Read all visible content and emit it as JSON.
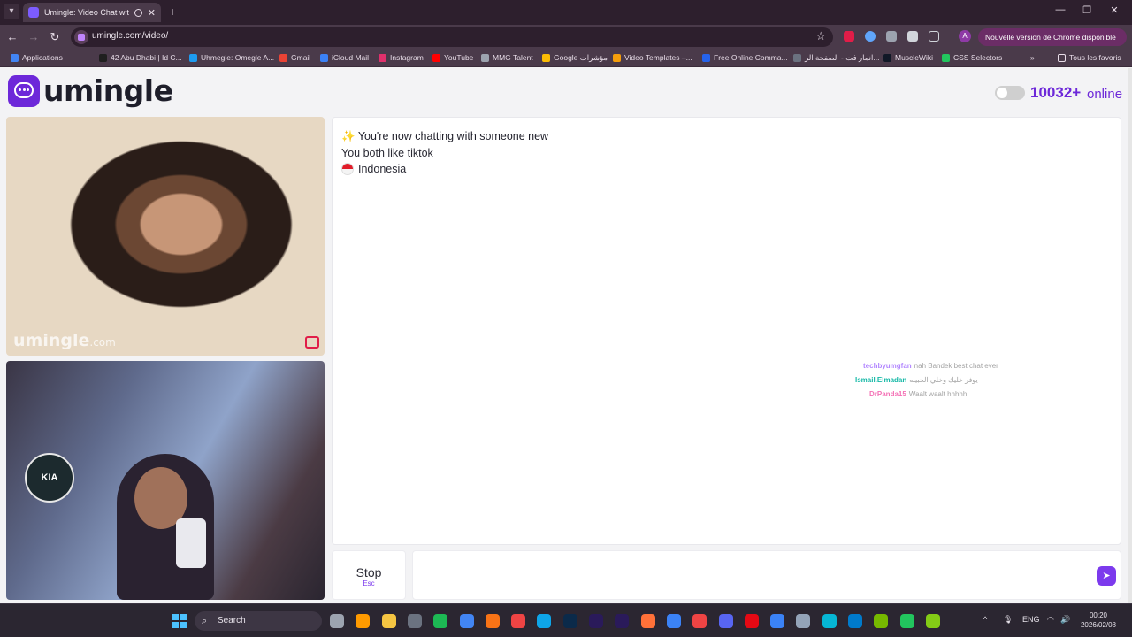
{
  "browser": {
    "tab_title": "Umingle: Video Chat with S",
    "url": "umingle.com/video/",
    "update_label": "Nouvelle version de Chrome disponible",
    "profile_initial": "A",
    "bookmarks": [
      {
        "label": "Applications",
        "color": "#4285f4"
      },
      {
        "label": "42 Abu Dhabi | Id C...",
        "color": "#1f1f1f"
      },
      {
        "label": "Uhmegle: Omegle A...",
        "color": "#1d9bf0"
      },
      {
        "label": "Gmail",
        "color": "#ea4335"
      },
      {
        "label": "iCloud Mail",
        "color": "#3b82f6"
      },
      {
        "label": "Instagram",
        "color": "#e1306c"
      },
      {
        "label": "YouTube",
        "color": "#ff0000"
      },
      {
        "label": "MMG Talent",
        "color": "#9ca3af"
      },
      {
        "label": "Google مؤشرات",
        "color": "#fbbc05"
      },
      {
        "label": "Video Templates –...",
        "color": "#f59e0b"
      },
      {
        "label": "Free Online Comma...",
        "color": "#2563eb"
      },
      {
        "label": "انمار فت - الصفحة الر...",
        "color": "#6b7280"
      },
      {
        "label": "MuscleWiki",
        "color": "#111827"
      },
      {
        "label": "CSS Selectors",
        "color": "#22c55e"
      }
    ],
    "bookmarks_overflow": "»",
    "all_bookmarks": "Tous les favoris"
  },
  "page": {
    "logo": "umingle",
    "online_count": "10032+",
    "online_label": "online",
    "watermark_main": "umingle",
    "watermark_suffix": ".com",
    "chat": {
      "title_icon": "✨",
      "title": "You're now chatting with someone new",
      "interest": "You both like tiktok",
      "country": "Indonesia"
    },
    "ticker": [
      {
        "name": "techbyumgfan",
        "text": "nah Bandek best chat ever",
        "color": "#b388ff"
      },
      {
        "name": "Ismail.Elmadan",
        "text": "يوفر خليك وخلي الحبيبه",
        "color": "#14b8a6"
      },
      {
        "name": "DrPanda15",
        "text": "Waalt waalt hhhhh",
        "color": "#f472b6"
      }
    ],
    "stop_label": "Stop",
    "stop_key": "Esc",
    "input_placeholder": "",
    "self_badge": "KIA"
  },
  "taskbar": {
    "search_label": "Search",
    "lang": "ENG",
    "time": "00:20",
    "date": "2026/02/08",
    "apps": [
      {
        "name": "task-view",
        "color": "#9ca3af"
      },
      {
        "name": "illustrator",
        "color": "#ff9a00"
      },
      {
        "name": "file-explorer",
        "color": "#f5c542"
      },
      {
        "name": "settings",
        "color": "#6b7280"
      },
      {
        "name": "spotify",
        "color": "#1db954"
      },
      {
        "name": "chrome",
        "color": "#4285f4"
      },
      {
        "name": "fl-studio",
        "color": "#f97316"
      },
      {
        "name": "opera",
        "color": "#ef4444"
      },
      {
        "name": "edge",
        "color": "#0ea5e9"
      },
      {
        "name": "photoshop",
        "color": "#0b2a4a"
      },
      {
        "name": "after-effects",
        "color": "#2a1a5a"
      },
      {
        "name": "premiere",
        "color": "#2a1a5a"
      },
      {
        "name": "firefox",
        "color": "#ff7139"
      },
      {
        "name": "remote-desktop",
        "color": "#3b82f6"
      },
      {
        "name": "anydesk",
        "color": "#ef4444"
      },
      {
        "name": "discord",
        "color": "#5865f2"
      },
      {
        "name": "netflix",
        "color": "#e50914"
      },
      {
        "name": "steam-app",
        "color": "#3b82f6"
      },
      {
        "name": "mountain-app",
        "color": "#94a3b8"
      },
      {
        "name": "edge-dev",
        "color": "#06b6d4"
      },
      {
        "name": "vscode",
        "color": "#007acc"
      },
      {
        "name": "nvidia",
        "color": "#76b900"
      },
      {
        "name": "xbox",
        "color": "#22c55e"
      },
      {
        "name": "terminal",
        "color": "#84cc16"
      }
    ]
  }
}
